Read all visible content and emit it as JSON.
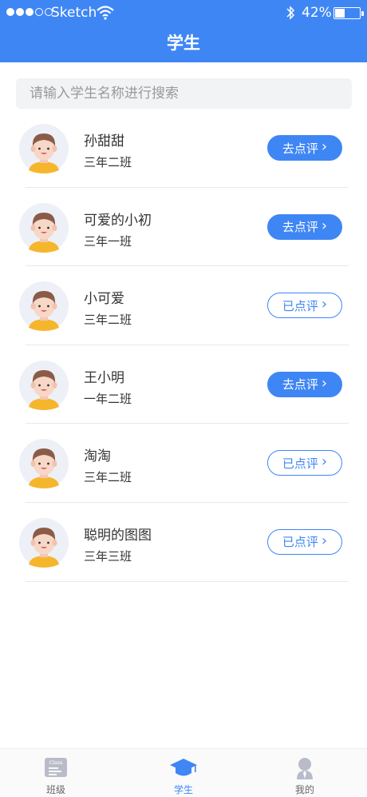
{
  "status_bar": {
    "carrier": "Sketch",
    "battery": "42%",
    "battery_level": 0.42
  },
  "header": {
    "title": "学生"
  },
  "search": {
    "placeholder": "请输入学生名称进行搜索"
  },
  "students": [
    {
      "name": "孙甜甜",
      "class": "三年二班",
      "action": "去点评",
      "state": "pending"
    },
    {
      "name": "可爱的小初",
      "class": "三年一班",
      "action": "去点评",
      "state": "pending"
    },
    {
      "name": "小可爱",
      "class": "三年二班",
      "action": "已点评",
      "state": "reviewed"
    },
    {
      "name": "王小明",
      "class": "一年二班",
      "action": "去点评",
      "state": "pending"
    },
    {
      "name": "淘淘",
      "class": "三年二班",
      "action": "已点评",
      "state": "reviewed"
    },
    {
      "name": "聪明的图图",
      "class": "三年三班",
      "action": "已点评",
      "state": "reviewed"
    }
  ],
  "tabbar": {
    "items": [
      {
        "label": "班级",
        "icon": "class-board-icon",
        "board_text": "Class",
        "active": false
      },
      {
        "label": "学生",
        "icon": "graduation-cap-icon",
        "active": true
      },
      {
        "label": "我的",
        "icon": "person-icon",
        "active": false
      }
    ]
  },
  "colors": {
    "primary": "#3f86f5",
    "text": "#333333",
    "divider": "#e8e8e8"
  }
}
